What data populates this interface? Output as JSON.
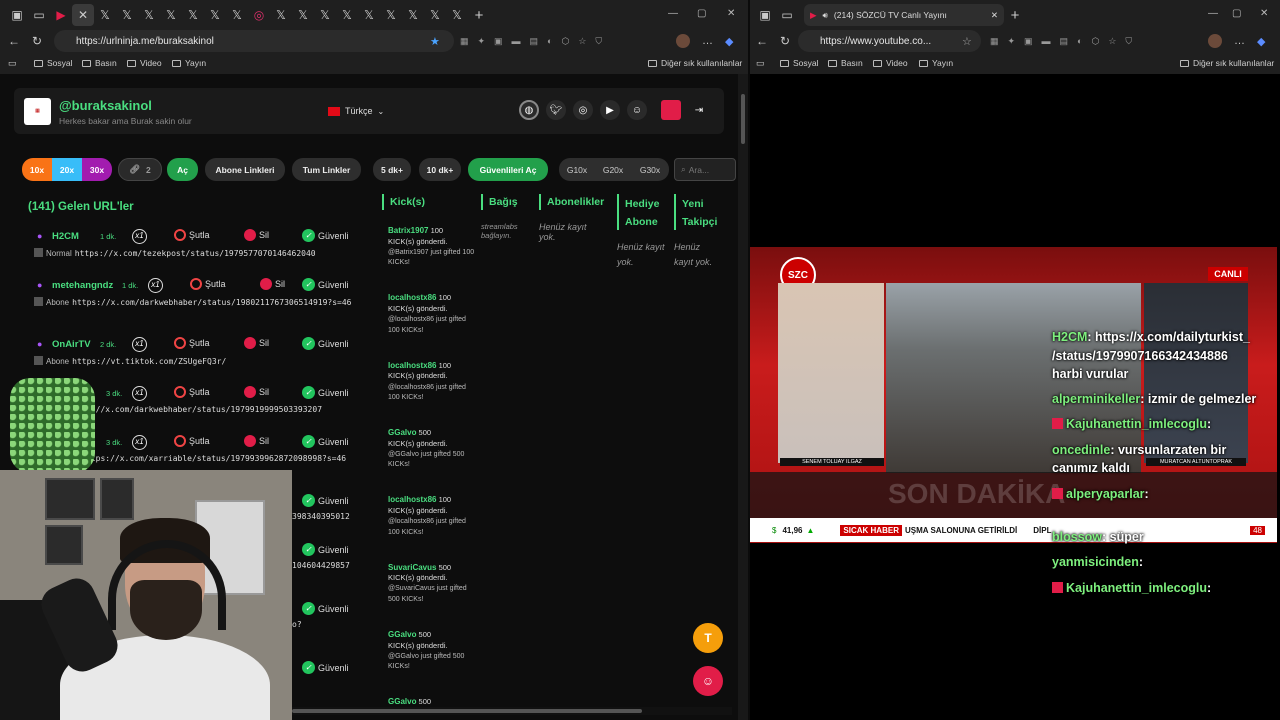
{
  "left_browser": {
    "url": "https://urlninja.me/buraksakinol",
    "bookmarks": [
      "Sosyal",
      "Basın",
      "Video",
      "Yayın"
    ],
    "other_bookmarks": "Diğer sık kullanılanlar"
  },
  "right_browser": {
    "tab_title": "(214) SÖZCÜ TV Canlı Yayını",
    "url": "https://www.youtube.co...",
    "bookmarks": [
      "Sosyal",
      "Basın",
      "Video",
      "Yayın"
    ],
    "other_bookmarks": "Diğer sık kullanılanlar"
  },
  "profile": {
    "handle": "@buraksakinol",
    "tagline": "Herkes bakar ama Burak sakin olur",
    "language": "Türkçe"
  },
  "filters": {
    "b10x": "10x",
    "b20x": "20x",
    "b30x": "30x",
    "link_count": "2",
    "ac": "Aç",
    "abone": "Abone Linkleri",
    "tum": "Tum Linkler",
    "dk5": "5 dk+",
    "dk10": "10 dk+",
    "guvenli": "Güvenlileri Aç",
    "g10": "G10x",
    "g20": "G20x",
    "g30": "G30x",
    "search_placeholder": "Ara..."
  },
  "incoming": {
    "title": "(141) Gelen URL'ler",
    "actions": {
      "x1": "x1",
      "sutla": "Şutla",
      "sil": "Sil",
      "guvenli": "Güvenli"
    },
    "rows": [
      {
        "name": "H2CM",
        "time": "1 dk.",
        "type": "Normal",
        "url": "https://x.com/tezekpost/status/1979577070146462040"
      },
      {
        "name": "metehangndz",
        "time": "1 dk.",
        "type": "Abone",
        "url": "https://x.com/darkwebhaber/status/1980211767306514919?s=46"
      },
      {
        "name": "OnAirTV",
        "time": "2 dk.",
        "type": "Abone",
        "url": "https://vt.tiktok.com/ZSUgeFQ3r/"
      },
      {
        "name": "",
        "time": "3 dk.",
        "type": "",
        "url": "s://x.com/darkwebhaber/status/1979919999503393207"
      },
      {
        "name": "",
        "time": "3 dk.",
        "type": "",
        "url": "ttps://x.com/xarriable/status/1979939962872098998?s=46"
      },
      {
        "name": "",
        "time": "",
        "type": "",
        "url": "398340395012"
      },
      {
        "name": "",
        "time": "",
        "type": "",
        "url": "104604429857"
      },
      {
        "name": "",
        "time": "",
        "type": "",
        "url": "o?"
      },
      {
        "name": "",
        "time": "",
        "type": "",
        "url": ""
      }
    ]
  },
  "columns": {
    "kick": "Kick(s)",
    "bagis": "Bağış",
    "abonelikler": "Abonelikler",
    "hediye": "Hediye Abone",
    "yeni": "Yeni Takipçi",
    "streamlabs": "streamlabs bağlayın.",
    "empty": "Henüz kayıt yok."
  },
  "kicks": [
    {
      "user": "Batrix1907",
      "amount": "100",
      "text": "KICK(s) gönderdi.",
      "sub": "@Batrix1907 just gifted 100 KICKs!"
    },
    {
      "user": "localhostx86",
      "amount": "100",
      "text": "KICK(s) gönderdi.",
      "sub": "@localhostx86 just gifted 100 KICKs!"
    },
    {
      "user": "localhostx86",
      "amount": "100",
      "text": "KICK(s) gönderdi.",
      "sub": "@localhostx86 just gifted 100 KICKs!"
    },
    {
      "user": "GGalvo",
      "amount": "500",
      "text": "KICK(s) gönderdi.",
      "sub": "@GGalvo just gifted 500 KICKs!"
    },
    {
      "user": "localhostx86",
      "amount": "100",
      "text": "KICK(s) gönderdi.",
      "sub": "@localhostx86 just gifted 100 KICKs!"
    },
    {
      "user": "SuvariCavus",
      "amount": "500",
      "text": "KICK(s) gönderdi.",
      "sub": "@SuvariCavus just gifted 500 KICKs!"
    },
    {
      "user": "GGalvo",
      "amount": "500",
      "text": "KICK(s) gönderdi.",
      "sub": "@GGalvo just gifted 500 KICKs!"
    },
    {
      "user": "GGalvo",
      "amount": "500",
      "text": "",
      "sub": ""
    }
  ],
  "fab_t": "T",
  "video": {
    "channel": "SZC",
    "live": "CANLI",
    "anchor_left": "SENEM TOLUAY ILGAZ",
    "anchor_right": "MURATCAN ALTUNTOPRAK",
    "son_dakika": "SON DAKİKA",
    "ticker_value": "41,96",
    "ticker_tag": "SICAK HABER",
    "ticker_text": "UŞMA SALONUNA GETİRİLDİ",
    "ticker_more": "DİPL",
    "clock": "48"
  },
  "chat": [
    {
      "user": "H2CM",
      "msg": ": https://x.com/dailyturkist_"
    },
    {
      "user": "",
      "msg": "/status/1979907166342434886"
    },
    {
      "user": "",
      "msg": "harbi vurular"
    },
    {
      "user": "alperminikeller",
      "msg": ": izmir de gelmezler"
    },
    {
      "user": "Kajuhanettin_imlecoglu",
      "msg": ":"
    },
    {
      "user": "oncedinle",
      "msg": ": vursunlarzaten bir"
    },
    {
      "user": "",
      "msg": "canımız kaldı"
    },
    {
      "user": "alperyaparlar",
      "msg": ":"
    },
    {
      "user": "blossow",
      "msg": ": süper"
    },
    {
      "user": "yanmisicinden",
      "msg": ":"
    },
    {
      "user": "Kajuhanettin_imlecoglu",
      "msg": ":"
    }
  ],
  "colors": {
    "accent_green": "#4ade80",
    "kick_red": "#e11d48",
    "bg": "#0d0d0d"
  }
}
